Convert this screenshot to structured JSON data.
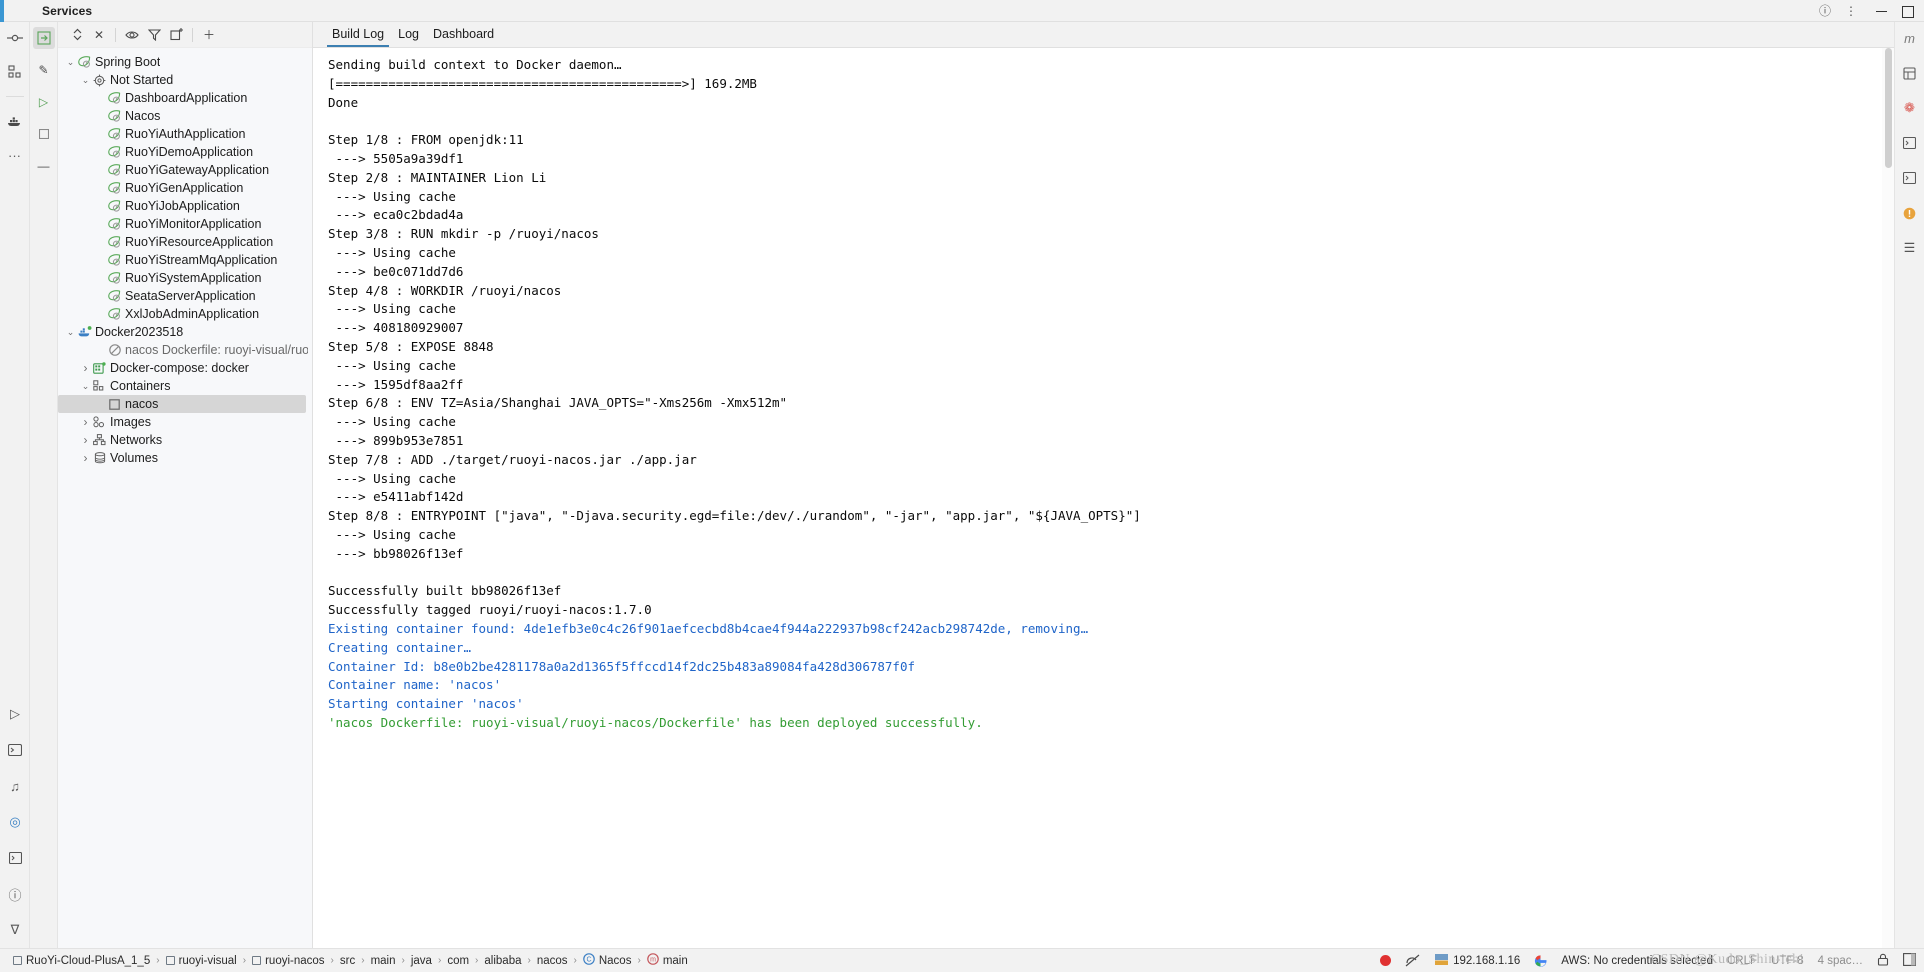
{
  "window": {
    "title": "Services",
    "icons": [
      "help-icon",
      "more-options-icon",
      "minimize-icon",
      "maximize-icon"
    ]
  },
  "left_rail": {
    "items": [
      {
        "name": "commit-icon",
        "glyph": "─○─"
      },
      {
        "name": "structure-icon",
        "glyph": "□"
      },
      {
        "name": "docker-icon",
        "glyph": "☸"
      },
      {
        "name": "more-icon",
        "glyph": "···"
      },
      {
        "name": "run-icon",
        "glyph": "▷"
      },
      {
        "name": "terminal-icon",
        "glyph": "⌨"
      },
      {
        "name": "tiktok-icon",
        "glyph": "♪"
      },
      {
        "name": "services-icon",
        "glyph": "◎"
      },
      {
        "name": "problems-icon",
        "glyph": "⌧"
      },
      {
        "name": "notifications-icon",
        "glyph": "ⓘ"
      },
      {
        "name": "git-branch-icon",
        "glyph": "⎇"
      }
    ]
  },
  "services_toolbar": {
    "buttons": [
      {
        "name": "rerun-services-icon",
        "glyph": "⇥",
        "selected": true
      },
      {
        "name": "edit-configuration-icon",
        "glyph": "✎",
        "selected": false
      },
      {
        "name": "run-icon",
        "glyph": "▷",
        "selected": false
      },
      {
        "name": "stop-icon",
        "glyph": "■",
        "selected": false
      },
      {
        "name": "collapse-icon",
        "glyph": "—",
        "selected": false
      }
    ]
  },
  "tree_toolbar": {
    "buttons": [
      {
        "name": "expand-collapse-icon",
        "glyph": "⌃"
      },
      {
        "name": "close-icon",
        "glyph": "✕"
      },
      {
        "name": "show-hide-icon",
        "glyph": "◉"
      },
      {
        "name": "filter-icon",
        "glyph": "∇"
      },
      {
        "name": "new-window-icon",
        "glyph": "⧉"
      },
      {
        "name": "add-icon",
        "glyph": "＋"
      }
    ]
  },
  "tree": {
    "rows": [
      {
        "label": "Spring Boot",
        "indent": 0,
        "twig": "⌄",
        "icon": "spring-boot-icon",
        "selected": false
      },
      {
        "label": "Not Started",
        "indent": 1,
        "twig": "⌄",
        "icon": "gear-icon",
        "selected": false
      },
      {
        "label": "DashboardApplication",
        "indent": 2,
        "twig": "",
        "icon": "spring-leaf-icon",
        "selected": false
      },
      {
        "label": "Nacos",
        "indent": 2,
        "twig": "",
        "icon": "spring-leaf-icon",
        "selected": false
      },
      {
        "label": "RuoYiAuthApplication",
        "indent": 2,
        "twig": "",
        "icon": "spring-leaf-icon",
        "selected": false
      },
      {
        "label": "RuoYiDemoApplication",
        "indent": 2,
        "twig": "",
        "icon": "spring-leaf-icon",
        "selected": false
      },
      {
        "label": "RuoYiGatewayApplication",
        "indent": 2,
        "twig": "",
        "icon": "spring-leaf-icon",
        "selected": false
      },
      {
        "label": "RuoYiGenApplication",
        "indent": 2,
        "twig": "",
        "icon": "spring-leaf-icon",
        "selected": false
      },
      {
        "label": "RuoYiJobApplication",
        "indent": 2,
        "twig": "",
        "icon": "spring-leaf-icon",
        "selected": false
      },
      {
        "label": "RuoYiMonitorApplication",
        "indent": 2,
        "twig": "",
        "icon": "spring-leaf-icon",
        "selected": false
      },
      {
        "label": "RuoYiResourceApplication",
        "indent": 2,
        "twig": "",
        "icon": "spring-leaf-icon",
        "selected": false
      },
      {
        "label": "RuoYiStreamMqApplication",
        "indent": 2,
        "twig": "",
        "icon": "spring-leaf-icon",
        "selected": false
      },
      {
        "label": "RuoYiSystemApplication",
        "indent": 2,
        "twig": "",
        "icon": "spring-leaf-icon",
        "selected": false
      },
      {
        "label": "SeataServerApplication",
        "indent": 2,
        "twig": "",
        "icon": "spring-leaf-icon",
        "selected": false
      },
      {
        "label": "XxlJobAdminApplication",
        "indent": 2,
        "twig": "",
        "icon": "spring-leaf-icon",
        "selected": false
      },
      {
        "label": "Docker2023518",
        "indent": 0,
        "twig": "⌄",
        "icon": "docker-icon",
        "selected": false
      },
      {
        "label": "nacos Dockerfile: ruoyi-visual/ruoyi-nacos/",
        "indent": 2,
        "twig": "",
        "icon": "not-allowed-icon",
        "selected": false
      },
      {
        "label": "Docker-compose: docker",
        "indent": 1,
        "twig": "›",
        "icon": "compose-icon",
        "selected": false
      },
      {
        "label": "Containers",
        "indent": 1,
        "twig": "⌄",
        "icon": "containers-icon",
        "selected": false
      },
      {
        "label": "nacos",
        "indent": 2,
        "twig": "",
        "icon": "container-stopped-icon",
        "selected": true
      },
      {
        "label": "Images",
        "indent": 1,
        "twig": "›",
        "icon": "images-icon",
        "selected": false
      },
      {
        "label": "Networks",
        "indent": 1,
        "twig": "›",
        "icon": "networks-icon",
        "selected": false
      },
      {
        "label": "Volumes",
        "indent": 1,
        "twig": "›",
        "icon": "volumes-icon",
        "selected": false
      }
    ]
  },
  "tabs": {
    "items": [
      {
        "label": "Build Log",
        "active": true
      },
      {
        "label": "Log",
        "active": false
      },
      {
        "label": "Dashboard",
        "active": false
      }
    ]
  },
  "build_log": {
    "lines": [
      {
        "text": "Sending build context to Docker daemon…",
        "color": "default"
      },
      {
        "text": "[==============================================>] 169.2MB",
        "color": "default"
      },
      {
        "text": "Done",
        "color": "default"
      },
      {
        "text": "",
        "color": "default"
      },
      {
        "text": "Step 1/8 : FROM openjdk:11",
        "color": "default"
      },
      {
        "text": " ---> 5505a9a39df1",
        "color": "default"
      },
      {
        "text": "Step 2/8 : MAINTAINER Lion Li",
        "color": "default"
      },
      {
        "text": " ---> Using cache",
        "color": "default"
      },
      {
        "text": " ---> eca0c2bdad4a",
        "color": "default"
      },
      {
        "text": "Step 3/8 : RUN mkdir -p /ruoyi/nacos",
        "color": "default"
      },
      {
        "text": " ---> Using cache",
        "color": "default"
      },
      {
        "text": " ---> be0c071dd7d6",
        "color": "default"
      },
      {
        "text": "Step 4/8 : WORKDIR /ruoyi/nacos",
        "color": "default"
      },
      {
        "text": " ---> Using cache",
        "color": "default"
      },
      {
        "text": " ---> 408180929007",
        "color": "default"
      },
      {
        "text": "Step 5/8 : EXPOSE 8848",
        "color": "default"
      },
      {
        "text": " ---> Using cache",
        "color": "default"
      },
      {
        "text": " ---> 1595df8aa2ff",
        "color": "default"
      },
      {
        "text": "Step 6/8 : ENV TZ=Asia/Shanghai JAVA_OPTS=\"-Xms256m -Xmx512m\"",
        "color": "default"
      },
      {
        "text": " ---> Using cache",
        "color": "default"
      },
      {
        "text": " ---> 899b953e7851",
        "color": "default"
      },
      {
        "text": "Step 7/8 : ADD ./target/ruoyi-nacos.jar ./app.jar",
        "color": "default"
      },
      {
        "text": " ---> Using cache",
        "color": "default"
      },
      {
        "text": " ---> e5411abf142d",
        "color": "default"
      },
      {
        "text": "Step 8/8 : ENTRYPOINT [\"java\", \"-Djava.security.egd=file:/dev/./urandom\", \"-jar\", \"app.jar\", \"${JAVA_OPTS}\"]",
        "color": "default"
      },
      {
        "text": " ---> Using cache",
        "color": "default"
      },
      {
        "text": " ---> bb98026f13ef",
        "color": "default"
      },
      {
        "text": "",
        "color": "default"
      },
      {
        "text": "Successfully built bb98026f13ef",
        "color": "default"
      },
      {
        "text": "Successfully tagged ruoyi/ruoyi-nacos:1.7.0",
        "color": "default"
      },
      {
        "text": "Existing container found: 4de1efb3e0c4c26f901aefcecbd8b4cae4f944a222937b98cf242acb298742de, removing…",
        "color": "blue"
      },
      {
        "text": "Creating container…",
        "color": "blue"
      },
      {
        "text": "Container Id: b8e0b2be4281178a0a2d1365f5ffccd14f2dc25b483a89084fa428d306787f0f",
        "color": "blue"
      },
      {
        "text": "Container name: 'nacos'",
        "color": "blue"
      },
      {
        "text": "Starting container 'nacos'",
        "color": "blue"
      },
      {
        "text": "'nacos Dockerfile: ruoyi-visual/ruoyi-nacos/Dockerfile' has been deployed successfully.",
        "color": "green"
      }
    ]
  },
  "right_rail": {
    "items": [
      {
        "name": "maven-icon",
        "glyph": "m"
      },
      {
        "name": "database-icon",
        "glyph": "◧"
      },
      {
        "name": "bean-icon",
        "glyph": "❁"
      },
      {
        "name": "code-icon-1",
        "glyph": "⎇"
      },
      {
        "name": "code-icon-2",
        "glyph": "⎇"
      },
      {
        "name": "warning-icon",
        "glyph": "●"
      },
      {
        "name": "layers-icon",
        "glyph": "☰"
      }
    ]
  },
  "status_bar": {
    "breadcrumbs": [
      {
        "label": "RuoYi-Cloud-PlusA_1_5",
        "icon": "module-icon"
      },
      {
        "label": "ruoyi-visual",
        "icon": "module-icon"
      },
      {
        "label": "ruoyi-nacos",
        "icon": "module-icon"
      },
      {
        "label": "src",
        "icon": ""
      },
      {
        "label": "main",
        "icon": ""
      },
      {
        "label": "java",
        "icon": ""
      },
      {
        "label": "com",
        "icon": ""
      },
      {
        "label": "alibaba",
        "icon": ""
      },
      {
        "label": "nacos",
        "icon": ""
      },
      {
        "label": "Nacos",
        "icon": "class-icon"
      },
      {
        "label": "main",
        "icon": "method-icon"
      }
    ],
    "right": {
      "recording_icon": "record-icon",
      "sftp_icon": "sftp-disconnected-icon",
      "host": "192.168.1.16",
      "google_icon": "google-icon",
      "aws": "AWS: No credentials selected",
      "line_sep": "CRLF",
      "encoding": "UTF-8",
      "indent": "4 spac…",
      "lock_icon": "lock-icon",
      "layout_icon": "layout-icon"
    },
    "watermark": "CSDN @Kudo_Shin-ichi"
  }
}
